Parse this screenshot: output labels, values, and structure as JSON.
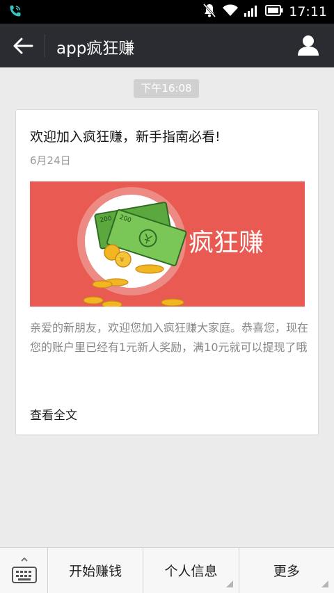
{
  "status_bar": {
    "time": "17:11",
    "icons": [
      "phone-call-icon",
      "mute-icon",
      "wifi-icon",
      "signal-icon",
      "battery-icon"
    ]
  },
  "nav": {
    "title": "app疯狂赚",
    "back_icon": "back-arrow-icon",
    "profile_icon": "user-profile-icon"
  },
  "chat": {
    "timestamp": "下午16:08"
  },
  "article": {
    "title": "欢迎加入疯狂赚，新手指南必看!",
    "date": "6月24日",
    "cover_text": "疯狂赚",
    "description": "亲爱的新朋友，欢迎您加入疯狂赚大家庭。恭喜您，现在您的账户里已经有1元新人奖励，满10元就可以提现了哦",
    "read_all": "查看全文"
  },
  "bottom_menu": {
    "keyboard_icon": "keyboard-icon",
    "items": [
      {
        "label": "开始赚钱",
        "has_submenu": false
      },
      {
        "label": "个人信息",
        "has_submenu": true
      },
      {
        "label": "更多",
        "has_submenu": true
      }
    ]
  },
  "colors": {
    "nav_bg": "#2a2c31",
    "cover_bg": "#e85a52",
    "money_green": "#6bbf4a",
    "coin_gold": "#f2b623"
  }
}
